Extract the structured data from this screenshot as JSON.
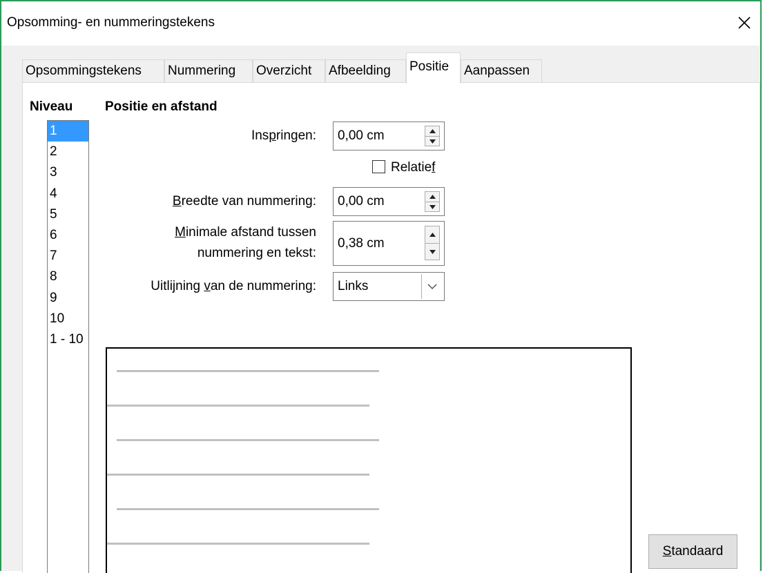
{
  "window": {
    "title": "Opsomming- en nummeringstekens",
    "close_icon": "close-icon"
  },
  "tabs": [
    {
      "label": "Opsommingstekens",
      "active": false
    },
    {
      "label": "Nummering",
      "active": false
    },
    {
      "label": "Overzicht",
      "active": false
    },
    {
      "label": "Afbeelding",
      "active": false
    },
    {
      "label": "Positie",
      "active": true
    },
    {
      "label": "Aanpassen",
      "active": false
    }
  ],
  "level": {
    "heading": "Niveau",
    "items": [
      "1",
      "2",
      "3",
      "4",
      "5",
      "6",
      "7",
      "8",
      "9",
      "10",
      "1 - 10"
    ],
    "selected": "1"
  },
  "position": {
    "heading": "Positie en afstand",
    "indent": {
      "label_pre": "Ins",
      "label_u": "p",
      "label_post": "ringen:",
      "value": "0,00 cm"
    },
    "relative": {
      "label_pre": "Relatie",
      "label_u": "f",
      "label_post": "",
      "checked": false
    },
    "numbering_width": {
      "label_pre": "",
      "label_u": "B",
      "label_post": "reedte van nummering:",
      "value": "0,00 cm"
    },
    "min_distance": {
      "line1_pre": "",
      "line1_u": "M",
      "line1_post": "inimale afstand tussen",
      "line2": "nummering en tekst:",
      "value": "0,38 cm"
    },
    "alignment": {
      "label_pre": "Uitlijning ",
      "label_u": "v",
      "label_post": "an de nummering:",
      "value": "Links"
    }
  },
  "buttons": {
    "default_pre": "",
    "default_u": "S",
    "default_post": "tandaard"
  },
  "colors": {
    "accent_border": "#2b9a56",
    "selection": "#3399ff",
    "preview_lines": "#c0c0c0"
  }
}
